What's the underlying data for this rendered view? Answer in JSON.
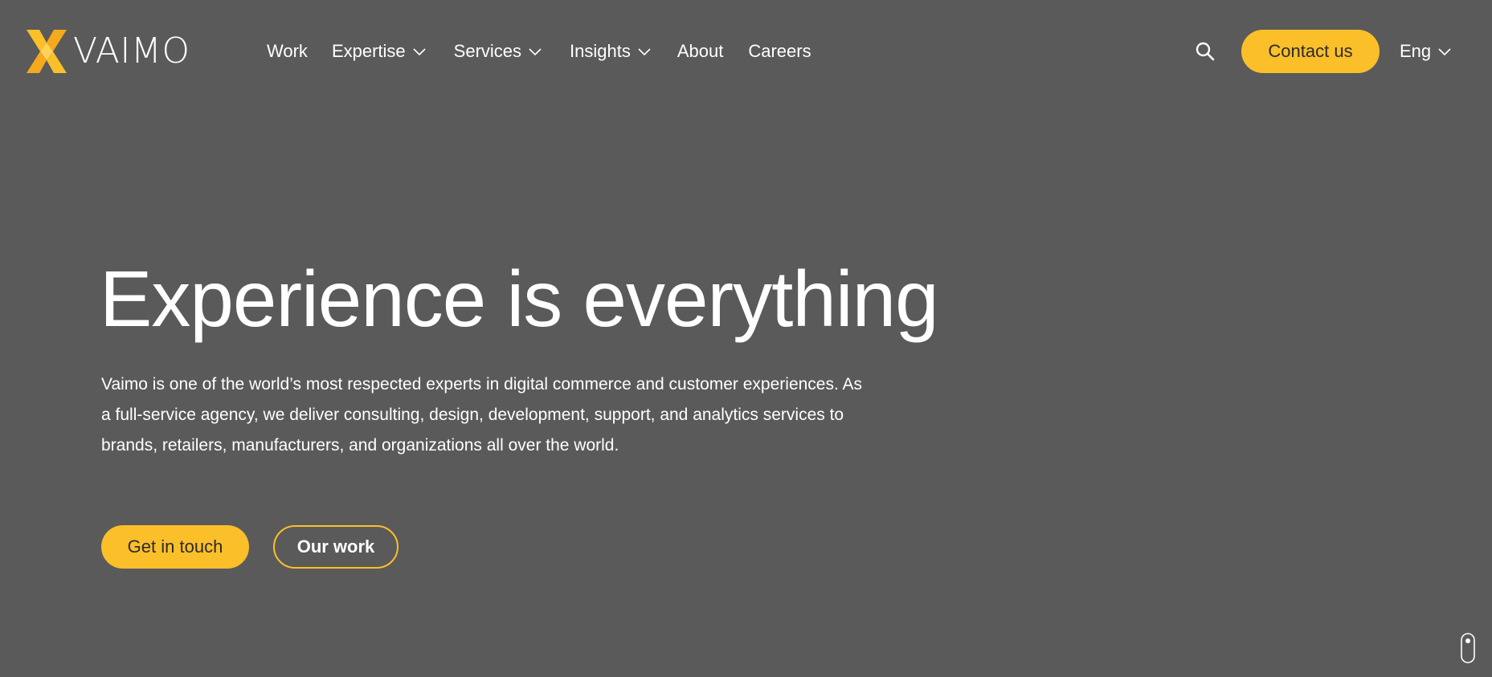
{
  "brand": {
    "name": "VAIMO",
    "logo_icon": "vaimo-x-icon",
    "accent_color": "#fbbf2a",
    "background_color": "#5a5a5a"
  },
  "nav": {
    "items": [
      {
        "label": "Work",
        "dropdown": false
      },
      {
        "label": "Expertise",
        "dropdown": true
      },
      {
        "label": "Services",
        "dropdown": true
      },
      {
        "label": "Insights",
        "dropdown": true
      },
      {
        "label": "About",
        "dropdown": false
      },
      {
        "label": "Careers",
        "dropdown": false
      }
    ]
  },
  "header": {
    "search_icon": "search-icon",
    "contact_label": "Contact us",
    "language_label": "Eng"
  },
  "hero": {
    "title": "Experience is everything",
    "description": "Vaimo is one of the world’s most respected experts in digital commerce and customer experiences. As a full-service agency, we deliver consulting, design, development, support, and analytics services to brands, retailers, manufacturers, and organizations all over the world.",
    "primary_button": "Get in touch",
    "secondary_button": "Our work"
  },
  "scroll_indicator_icon": "mouse-scroll-icon"
}
